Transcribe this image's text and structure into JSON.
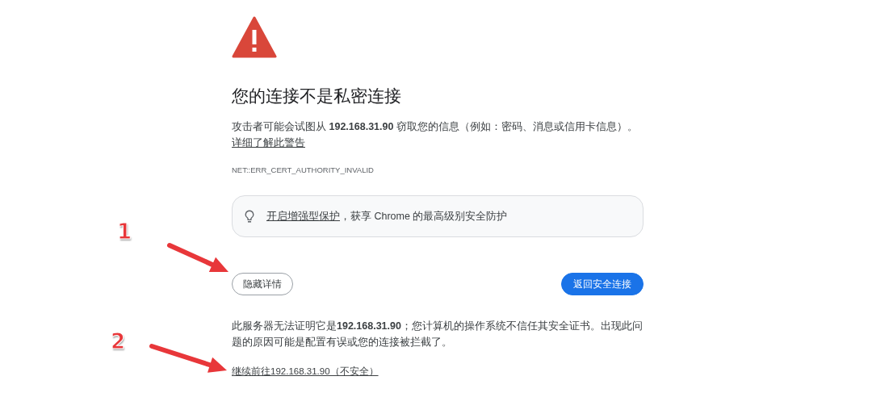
{
  "heading": "您的连接不是私密连接",
  "message": "攻击者可能会试图从 **192.168.31.90** 窃取您的信息（例如：密码、消息或信用卡信息）。",
  "learn_more_link": "详细了解此警告",
  "error_code": "NET::ERR_CERT_AUTHORITY_INVALID",
  "protection_card": {
    "link": "开启增强型保护",
    "text": "，获享 Chrome 的最高级别安全防护"
  },
  "buttons": [
    {
      "label": "隐藏详情",
      "kind": "secondary"
    },
    {
      "label": "返回安全连接",
      "kind": "primary"
    }
  ],
  "details": "此服务器无法证明它是**192.168.31.90**；您计算机的操作系统不信任其安全证书。出现此问题的原因可能是配置有误或您的连接被拦截了。",
  "proceed_link": "继续前往192.168.31.90（不安全）",
  "annotations": [
    {
      "number": "1"
    },
    {
      "number": "2"
    }
  ]
}
